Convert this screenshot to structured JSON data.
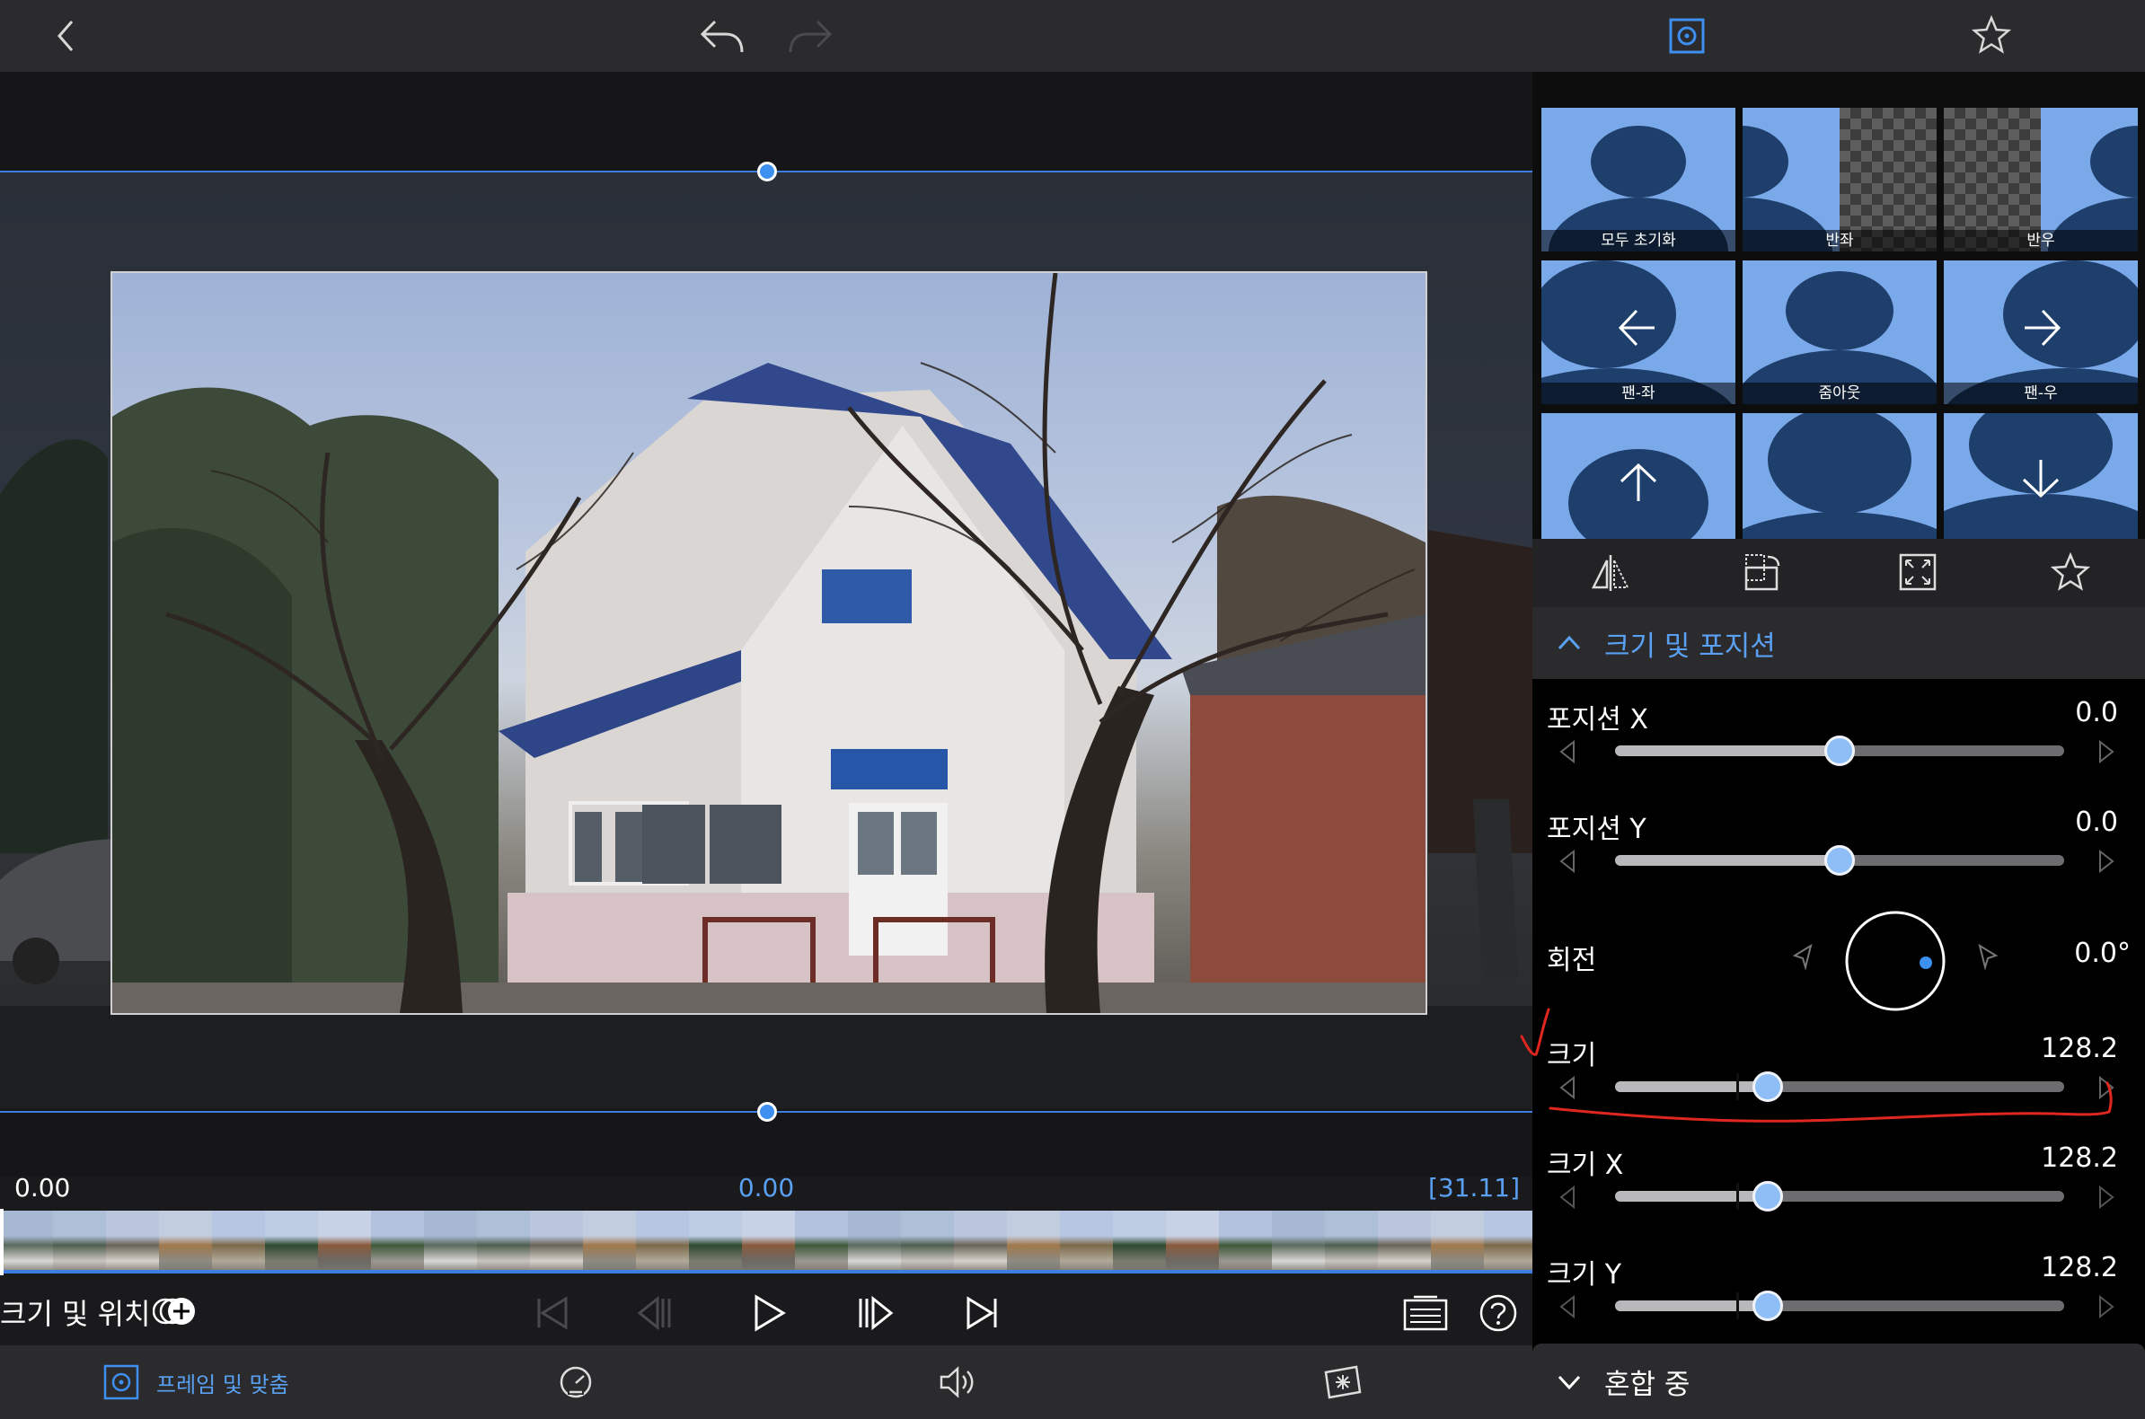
{
  "toolbar": {
    "back_icon": "chevron-left-icon",
    "undo_icon": "undo-icon",
    "redo_icon": "redo-icon",
    "frame_icon": "frame-fit-icon",
    "favorite_icon": "star-icon"
  },
  "timeline": {
    "start": "0.00",
    "current": "0.00",
    "duration": "[31.11]"
  },
  "controls": {
    "mode_label": "크기 및 위치",
    "add_keyframe_icon": "add-keyframe-icon"
  },
  "tabs": [
    {
      "label": "프레임 및 맞춤",
      "icon": "frame-fit-icon",
      "active": true
    },
    {
      "label": "",
      "icon": "speed-icon",
      "active": false
    },
    {
      "label": "",
      "icon": "volume-icon",
      "active": false
    },
    {
      "label": "",
      "icon": "effects-icon",
      "active": false
    }
  ],
  "presets": [
    {
      "label": "모두 초기화"
    },
    {
      "label": "반좌"
    },
    {
      "label": "반우"
    },
    {
      "label": "팬-좌"
    },
    {
      "label": "줌아웃"
    },
    {
      "label": "팬-우"
    },
    {
      "label": "",
      "arrow": "up"
    },
    {
      "label": ""
    },
    {
      "label": "",
      "arrow": "down"
    }
  ],
  "panel_tools": [
    "flip-icon",
    "rotate-icon",
    "fit-icon",
    "star-icon"
  ],
  "size_position": {
    "title": "크기 및 포지션",
    "position_x": {
      "label": "포지션 X",
      "value": "0.0",
      "fraction": 0.5
    },
    "position_y": {
      "label": "포지션 Y",
      "value": "0.0",
      "fraction": 0.5
    },
    "rotation": {
      "label": "회전",
      "value": "0.0°"
    },
    "scale": {
      "label": "크기",
      "value": "128.2",
      "fraction": 0.34
    },
    "scale_x": {
      "label": "크기 X",
      "value": "128.2",
      "fraction": 0.34
    },
    "scale_y": {
      "label": "크기 Y",
      "value": "128.2",
      "fraction": 0.34
    }
  },
  "blend": {
    "title": "혼합 중"
  },
  "colors": {
    "accent": "#3d8ff0",
    "knob": "#8fbef7",
    "tile": "#7aa9ea",
    "annotation": "#e0271f"
  }
}
